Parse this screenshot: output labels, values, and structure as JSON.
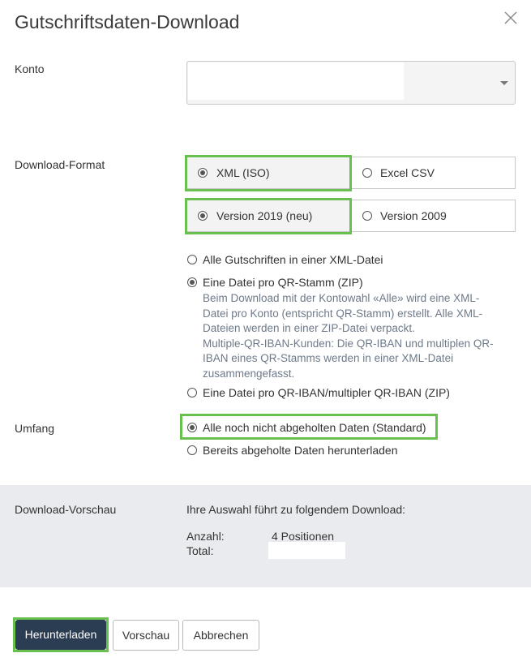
{
  "dialog": {
    "title": "Gutschriftsdaten-Download"
  },
  "konto": {
    "label": "Konto",
    "value": ""
  },
  "download_format": {
    "label": "Download-Format",
    "format_options": [
      "XML (ISO)",
      "Excel CSV"
    ],
    "format_selected": "XML (ISO)",
    "version_options": [
      "Version 2019 (neu)",
      "Version 2009"
    ],
    "version_selected": "Version 2019 (neu)",
    "file_options": [
      "Alle Gutschriften in einer XML-Datei",
      "Eine Datei pro QR-Stamm (ZIP)",
      "Eine Datei pro QR-IBAN/multipler QR-IBAN (ZIP)"
    ],
    "file_selected": "Eine Datei pro QR-Stamm (ZIP)",
    "file_description": [
      "Beim Download mit der Kontowahl «Alle» wird eine XML-",
      "Datei pro Konto (entspricht QR-Stamm) erstellt. Alle XML-",
      "Dateien werden in einer ZIP-Datei verpackt.",
      "Multiple-QR-IBAN-Kunden: Die QR-IBAN und multiplen QR-",
      "IBAN eines QR-Stamms werden in einer XML-Datei",
      "zusammengefasst."
    ]
  },
  "umfang": {
    "label": "Umfang",
    "options": [
      "Alle noch nicht abgeholten Daten (Standard)",
      "Bereits abgeholte Daten herunterladen"
    ],
    "selected": "Alle noch nicht abgeholten Daten (Standard)"
  },
  "preview": {
    "label": "Download-Vorschau",
    "intro": "Ihre Auswahl führt zu folgendem Download:",
    "count_label": "Anzahl:",
    "count_value": "4 Positionen",
    "total_label": "Total:",
    "total_value": ""
  },
  "buttons": {
    "download": "Herunterladen",
    "preview": "Vorschau",
    "cancel": "Abbrechen"
  },
  "colors": {
    "highlight": "#6ac04f",
    "primary_button": "#2b3d52",
    "preview_bg": "#e9ebee",
    "description_text": "#6e7a8a"
  }
}
